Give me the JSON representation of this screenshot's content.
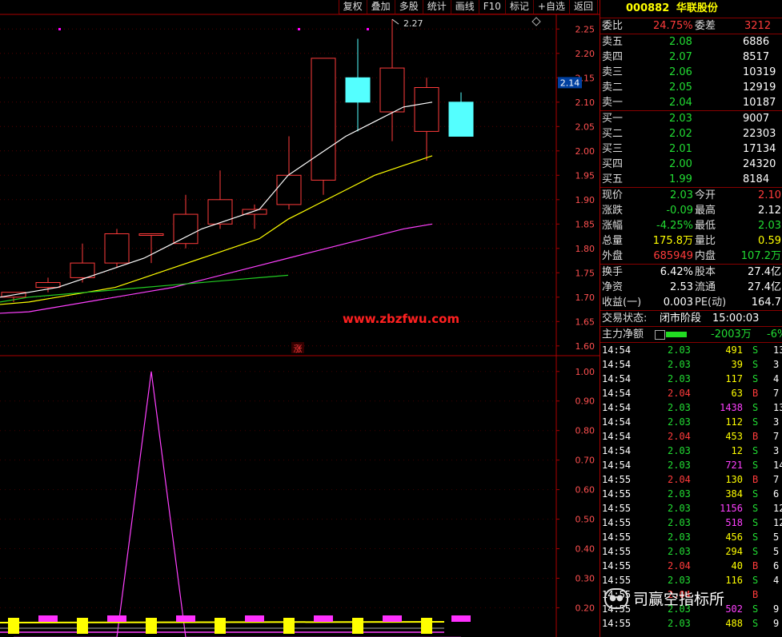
{
  "toolbar": [
    "复权",
    "叠加",
    "多股",
    "统计",
    "画线",
    "F10",
    "标记",
    "+自选",
    "返回"
  ],
  "stock": {
    "code": "000882",
    "name": "华联股份"
  },
  "weibi": {
    "label": "委比",
    "value": "24.75%",
    "diff_label": "委差",
    "diff": "3212"
  },
  "asks": [
    {
      "label": "卖五",
      "price": "2.08",
      "vol": "6886"
    },
    {
      "label": "卖四",
      "price": "2.07",
      "vol": "8517"
    },
    {
      "label": "卖三",
      "price": "2.06",
      "vol": "10319"
    },
    {
      "label": "卖二",
      "price": "2.05",
      "vol": "12919"
    },
    {
      "label": "卖一",
      "price": "2.04",
      "vol": "10187"
    }
  ],
  "bids": [
    {
      "label": "买一",
      "price": "2.03",
      "vol": "9007"
    },
    {
      "label": "买二",
      "price": "2.02",
      "vol": "22303"
    },
    {
      "label": "买三",
      "price": "2.01",
      "vol": "17134"
    },
    {
      "label": "买四",
      "price": "2.00",
      "vol": "24320"
    },
    {
      "label": "买五",
      "price": "1.99",
      "vol": "8184"
    }
  ],
  "quote": [
    {
      "l1": "现价",
      "v1": "2.03",
      "c1": "grn",
      "l2": "今开",
      "v2": "2.10",
      "c2": "red"
    },
    {
      "l1": "涨跌",
      "v1": "-0.09",
      "c1": "grn",
      "l2": "最高",
      "v2": "2.12",
      "c2": "wht"
    },
    {
      "l1": "涨幅",
      "v1": "-4.25%",
      "c1": "grn",
      "l2": "最低",
      "v2": "2.03",
      "c2": "grn"
    },
    {
      "l1": "总量",
      "v1": "175.8万",
      "c1": "yel",
      "l2": "量比",
      "v2": "0.59",
      "c2": "yel"
    },
    {
      "l1": "外盘",
      "v1": "685949",
      "c1": "red",
      "l2": "内盘",
      "v2": "107.2万",
      "c2": "grn"
    }
  ],
  "fund": [
    {
      "l1": "换手",
      "v1": "6.42%",
      "l2": "股本",
      "v2": "27.4亿"
    },
    {
      "l1": "净资",
      "v1": "2.53",
      "l2": "流通",
      "v2": "27.4亿"
    },
    {
      "l1": "收益(一)",
      "v1": "0.003",
      "l2": "PE(动)",
      "v2": "164.7"
    }
  ],
  "status": {
    "label": "交易状态:",
    "value": "闭市阶段",
    "time": "15:00:03"
  },
  "main_force": {
    "label": "主力净额",
    "value": "-2003万",
    "pct": "-6%"
  },
  "ticks": [
    {
      "t": "14:54",
      "p": "2.03",
      "v": "491",
      "s": "S",
      "n": "13"
    },
    {
      "t": "14:54",
      "p": "2.03",
      "v": "39",
      "s": "S",
      "n": "3"
    },
    {
      "t": "14:54",
      "p": "2.03",
      "v": "117",
      "s": "S",
      "n": "4"
    },
    {
      "t": "14:54",
      "p": "2.04",
      "v": "63",
      "s": "B",
      "n": "7"
    },
    {
      "t": "14:54",
      "p": "2.03",
      "v": "1438",
      "s": "S",
      "n": "13"
    },
    {
      "t": "14:54",
      "p": "2.03",
      "v": "112",
      "s": "S",
      "n": "3"
    },
    {
      "t": "14:54",
      "p": "2.04",
      "v": "453",
      "s": "B",
      "n": "7"
    },
    {
      "t": "14:54",
      "p": "2.03",
      "v": "12",
      "s": "S",
      "n": "3"
    },
    {
      "t": "14:54",
      "p": "2.03",
      "v": "721",
      "s": "S",
      "n": "14"
    },
    {
      "t": "14:55",
      "p": "2.04",
      "v": "130",
      "s": "B",
      "n": "7"
    },
    {
      "t": "14:55",
      "p": "2.03",
      "v": "384",
      "s": "S",
      "n": "6"
    },
    {
      "t": "14:55",
      "p": "2.03",
      "v": "1156",
      "s": "S",
      "n": "12"
    },
    {
      "t": "14:55",
      "p": "2.03",
      "v": "518",
      "s": "S",
      "n": "12"
    },
    {
      "t": "14:55",
      "p": "2.03",
      "v": "456",
      "s": "S",
      "n": "5"
    },
    {
      "t": "14:55",
      "p": "2.03",
      "v": "294",
      "s": "S",
      "n": "5"
    },
    {
      "t": "14:55",
      "p": "2.04",
      "v": "40",
      "s": "B",
      "n": "6"
    },
    {
      "t": "14:55",
      "p": "2.03",
      "v": "116",
      "s": "S",
      "n": "4"
    },
    {
      "t": "14:55",
      "p": "2.04",
      "v": "",
      "s": "B",
      "n": ""
    },
    {
      "t": "14:55",
      "p": "2.03",
      "v": "502",
      "s": "S",
      "n": "9"
    },
    {
      "t": "14:55",
      "p": "2.03",
      "v": "488",
      "s": "S",
      "n": "9"
    }
  ],
  "watermark_site": "www.zbzfwu.com",
  "watermark_brand": "司赢空指标所",
  "chart_marker": "涨",
  "current_price_tag": "2.14",
  "chart_data": {
    "type": "candlestick",
    "price_axis": {
      "ticks": [
        "2.25",
        "2.20",
        "2.15",
        "2.10",
        "2.05",
        "2.00",
        "1.95",
        "1.90",
        "1.85",
        "1.80",
        "1.75",
        "1.70",
        "1.65",
        "1.60"
      ],
      "min": 1.58,
      "max": 2.28
    },
    "max_label": "2.27",
    "candles": [
      {
        "o": 1.7,
        "c": 1.71,
        "h": 1.71,
        "l": 1.69
      },
      {
        "o": 1.72,
        "c": 1.73,
        "h": 1.74,
        "l": 1.71
      },
      {
        "o": 1.74,
        "c": 1.77,
        "h": 1.81,
        "l": 1.73
      },
      {
        "o": 1.77,
        "c": 1.83,
        "h": 1.84,
        "l": 1.76
      },
      {
        "o": 1.83,
        "c": 1.83,
        "h": 1.83,
        "l": 1.77
      },
      {
        "o": 1.81,
        "c": 1.87,
        "h": 1.91,
        "l": 1.8
      },
      {
        "o": 1.85,
        "c": 1.9,
        "h": 1.96,
        "l": 1.84
      },
      {
        "o": 1.87,
        "c": 1.88,
        "h": 1.89,
        "l": 1.84
      },
      {
        "o": 1.89,
        "c": 1.95,
        "h": 2.03,
        "l": 1.88
      },
      {
        "o": 1.94,
        "c": 2.19,
        "h": 2.19,
        "l": 1.91
      },
      {
        "o": 2.15,
        "c": 2.1,
        "h": 2.23,
        "l": 2.04
      },
      {
        "o": 2.08,
        "c": 2.17,
        "h": 2.27,
        "l": 2.02
      },
      {
        "o": 2.04,
        "c": 2.13,
        "h": 2.15,
        "l": 1.98
      },
      {
        "o": 2.1,
        "c": 2.03,
        "h": 2.12,
        "l": 2.03
      }
    ],
    "ma": [
      {
        "color": "#ffffff",
        "values": [
          1.7,
          1.71,
          1.72,
          1.74,
          1.76,
          1.78,
          1.81,
          1.84,
          1.86,
          1.88,
          1.95,
          1.99,
          2.03,
          2.06,
          2.09,
          2.1
        ]
      },
      {
        "color": "#ffff00",
        "values": [
          1.685,
          1.69,
          1.7,
          1.71,
          1.72,
          1.74,
          1.76,
          1.78,
          1.8,
          1.82,
          1.86,
          1.89,
          1.92,
          1.95,
          1.97,
          1.99
        ]
      },
      {
        "color": "#ff40ff",
        "values": [
          1.667,
          1.67,
          1.68,
          1.69,
          1.7,
          1.71,
          1.72,
          1.735,
          1.75,
          1.765,
          1.78,
          1.795,
          1.81,
          1.825,
          1.84,
          1.85
        ]
      },
      {
        "color": "#22cc22",
        "values": [
          1.69,
          1.7,
          1.705,
          1.71,
          1.715,
          1.72,
          1.725,
          1.73,
          1.735,
          1.74,
          1.745
        ]
      }
    ],
    "indicator_axis": {
      "ticks": [
        "1.00",
        "0.90",
        "0.80",
        "0.70",
        "0.60",
        "0.50",
        "0.40",
        "0.30",
        "0.20"
      ],
      "min": 0.12,
      "max": 1.04
    },
    "indicator_line": [
      0.1,
      0.1,
      0.1,
      0.1,
      1.0,
      0.1,
      0.1,
      0.1,
      0.1,
      0.1,
      0.1,
      0.1,
      0.1,
      0.1
    ]
  }
}
